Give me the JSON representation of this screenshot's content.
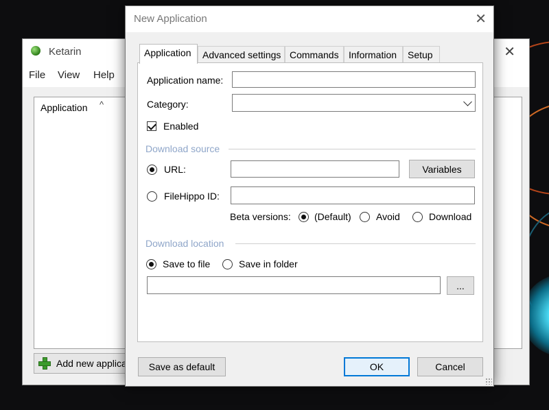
{
  "main_window": {
    "title": "Ketarin",
    "menu": [
      "File",
      "View",
      "Help"
    ],
    "list_column_header": "Application",
    "add_button_label": "Add new applica"
  },
  "dialog": {
    "title": "New Application",
    "tabs": [
      {
        "label": "Application",
        "active": true
      },
      {
        "label": "Advanced settings",
        "active": false
      },
      {
        "label": "Commands",
        "active": false
      },
      {
        "label": "Information",
        "active": false
      },
      {
        "label": "Setup",
        "active": false
      }
    ],
    "application_name": {
      "label": "Application name:",
      "value": ""
    },
    "category": {
      "label": "Category:",
      "value": ""
    },
    "enabled": {
      "label": "Enabled",
      "checked": true
    },
    "download_source": {
      "group_label": "Download source",
      "url": {
        "label": "URL:",
        "value": "",
        "selected": true
      },
      "variables_button": "Variables",
      "filehippo": {
        "label": "FileHippo ID:",
        "value": "",
        "selected": false
      },
      "beta_versions": {
        "label": "Beta versions:",
        "options": [
          {
            "label": "(Default)",
            "selected": true
          },
          {
            "label": "Avoid",
            "selected": false
          },
          {
            "label": "Download",
            "selected": false
          }
        ]
      }
    },
    "download_location": {
      "group_label": "Download location",
      "options": [
        {
          "label": "Save to file",
          "selected": true
        },
        {
          "label": "Save in folder",
          "selected": false
        }
      ],
      "path_value": "",
      "browse_button": "..."
    },
    "buttons": {
      "save_default": "Save as default",
      "ok": "OK",
      "cancel": "Cancel"
    }
  },
  "colors": {
    "group_label": "#8fa6c9",
    "default_button_border": "#0078d7"
  }
}
